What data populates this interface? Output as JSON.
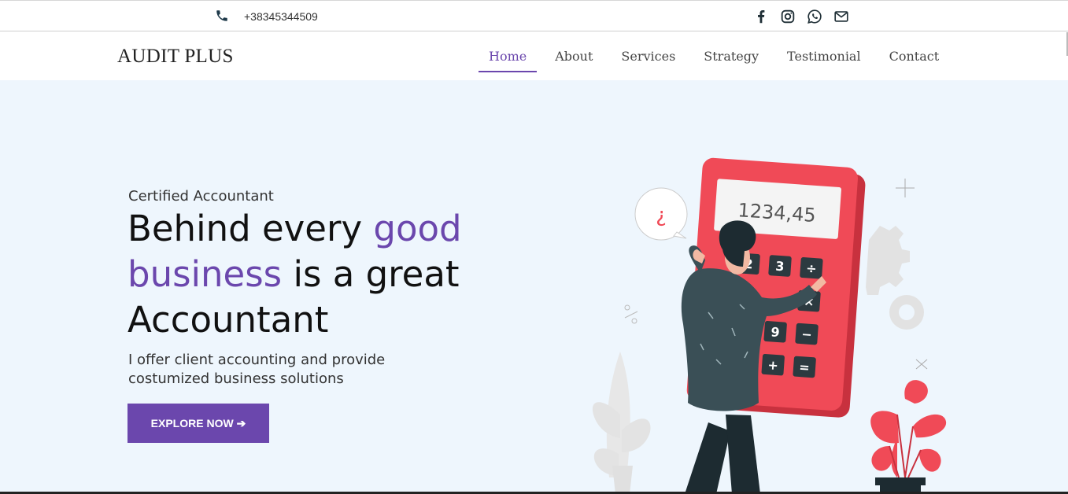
{
  "topbar": {
    "phone": "+38345344509",
    "social_icons": [
      "facebook-icon",
      "instagram-icon",
      "whatsapp-icon",
      "envelope-icon"
    ]
  },
  "header": {
    "logo": "AUDIT PLUS",
    "nav": [
      {
        "label": "Home",
        "active": true
      },
      {
        "label": "About",
        "active": false
      },
      {
        "label": "Services",
        "active": false
      },
      {
        "label": "Strategy",
        "active": false
      },
      {
        "label": "Testimonial",
        "active": false
      },
      {
        "label": "Contact",
        "active": false
      }
    ]
  },
  "hero": {
    "eyebrow": "Certified Accountant",
    "headline_part1": "Behind every ",
    "headline_highlight": "good business",
    "headline_part2": " is a great Accountant",
    "subtitle": "I offer client accounting and provide costumized business solutions",
    "cta_label": "EXPLORE NOW ➔",
    "calculator_display": "1234,45"
  },
  "colors": {
    "accent": "#6b47ad",
    "hero_bg": "#eef6fd",
    "calculator": "#f04a57",
    "dark": "#1f2f36"
  }
}
